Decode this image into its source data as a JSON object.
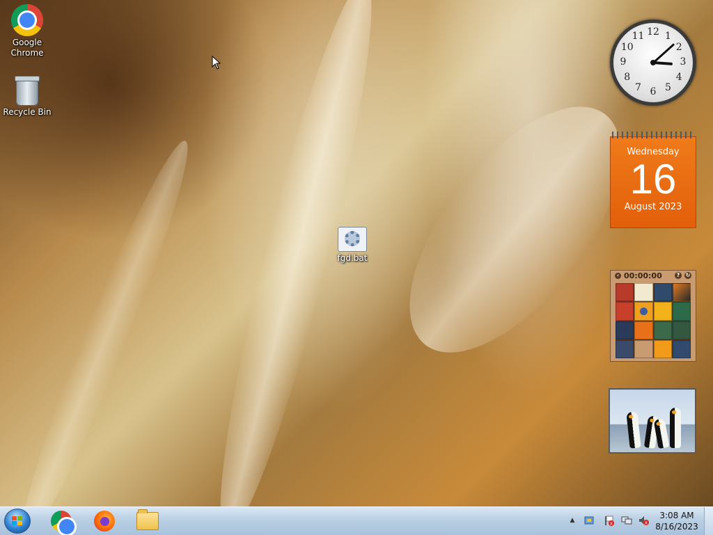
{
  "desktop": {
    "icons": [
      {
        "label_line1": "Google",
        "label_line2": "Chrome",
        "icon": "chrome-icon"
      },
      {
        "label_line1": "Recycle Bin",
        "label_line2": "",
        "icon": "recycle-bin-icon"
      },
      {
        "label_line1": "fgd.bat",
        "label_line2": "",
        "icon": "batch-file-icon"
      }
    ]
  },
  "gadgets": {
    "clock": {
      "numbers": [
        "12",
        "1",
        "2",
        "3",
        "4",
        "5",
        "6",
        "7",
        "8",
        "9",
        "10",
        "11"
      ],
      "time_hours": 3,
      "time_minutes": 8
    },
    "calendar": {
      "weekday": "Wednesday",
      "day": "16",
      "month_year": "August 2023",
      "color": "#e8680f"
    },
    "puzzle": {
      "timer": "00:00:00",
      "help_icon": "help-icon",
      "shuffle_icon": "shuffle-icon",
      "back_icon": "back-arrow-icon"
    },
    "slideshow": {
      "subject": "penguins-photo"
    }
  },
  "taskbar": {
    "start_icon": "windows-start-icon",
    "pinned": [
      {
        "name": "chrome",
        "icon": "chrome-icon"
      },
      {
        "name": "firefox",
        "icon": "firefox-icon"
      },
      {
        "name": "file-explorer",
        "icon": "folder-icon"
      }
    ],
    "tray": {
      "show_hidden": "▲",
      "time": "3:08 AM",
      "date": "8/16/2023"
    }
  }
}
